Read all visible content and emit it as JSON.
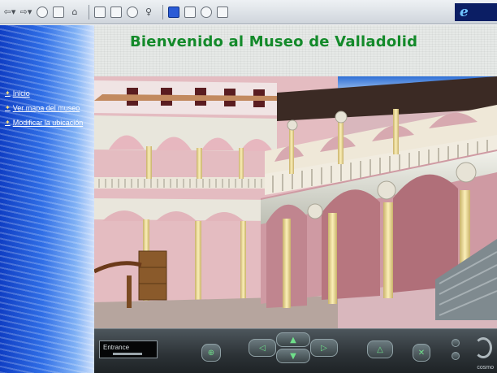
{
  "header": {
    "title": "Bienvenido al Museo de Valladolid"
  },
  "sidebar": {
    "items": [
      {
        "label": "Inicio"
      },
      {
        "label": "Ver mapa del museo"
      },
      {
        "label": "Modificar la ubicación"
      }
    ]
  },
  "toolbar": {
    "icons": [
      "back-icon",
      "forward-icon",
      "stop-icon",
      "refresh-icon",
      "home-icon",
      "search-icon",
      "favorites-icon",
      "history-icon",
      "channels-icon",
      "fullscreen-icon",
      "mail-icon",
      "print-icon",
      "edit-icon"
    ],
    "brand_logo": "e"
  },
  "navigator": {
    "viewpoint_label": "Entrance",
    "brand": "cosmo"
  },
  "colors": {
    "title_green": "#138a2a",
    "sidebar_blue": "#1f55d4",
    "wall_pink": "#e2b8bd",
    "column_cream": "#f3e2a6",
    "control_dark": "#2c3236"
  }
}
